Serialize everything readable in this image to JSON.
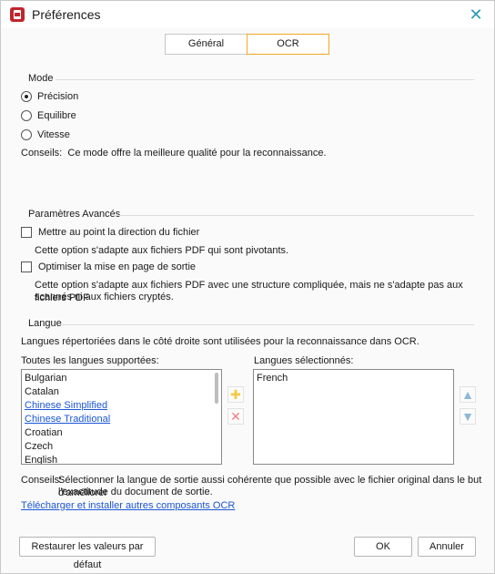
{
  "window": {
    "title": "Préférences"
  },
  "tabs": [
    {
      "label": "Général",
      "active": false
    },
    {
      "label": "OCR",
      "active": true
    }
  ],
  "mode": {
    "title": "Mode",
    "options": [
      {
        "label": "Précision",
        "checked": true
      },
      {
        "label": "Equilibre",
        "checked": false
      },
      {
        "label": "Vitesse",
        "checked": false
      }
    ],
    "tip_prefix": "Conseils:",
    "tip_text": "Ce mode offre la meilleure qualité pour la reconnaissance."
  },
  "advanced": {
    "title": "Paramètres Avancés",
    "option1_label": "Mettre au point la direction du fichier",
    "option1_checked": false,
    "option1_desc": "Cette option s'adapte aux fichiers PDF qui sont pivotants.",
    "option2_label": "Optimiser la mise en page de sortie",
    "option2_checked": false,
    "option2_desc_line1": "Cette option s'adapte aux fichiers PDF avec une structure compliquée, mais ne s'adapte pas aux fichiers PDF",
    "option2_desc_line2": "scannés ni aux fichiers cryptés."
  },
  "language": {
    "title": "Langue",
    "intro": "Langues répertoriées dans le côté droite sont utilisées pour la reconnaissance dans OCR.",
    "supported_label": "Toutes les langues supportées:",
    "selected_label": "Langues sélectionnés:",
    "supported": [
      "Bulgarian",
      "Catalan",
      "Chinese Simplified",
      "Chinese Traditional",
      "Croatian",
      "Czech",
      "English"
    ],
    "selected": [
      "French"
    ],
    "tip_prefix": "Conseils:",
    "tip_line1": "Sélectionner la langue de sortie aussi cohérente que possible avec le fichier original dans le but d'améliorer",
    "tip_line2": "l'exactitude du document de sortie.",
    "download_link": "Télécharger et installer autres composants OCR"
  },
  "icons": {
    "add": "plus-icon",
    "remove": "x-icon",
    "up": "arrow-up-icon",
    "down": "arrow-down-icon",
    "close": "close-icon",
    "accent_color": "#f5a623"
  },
  "footer": {
    "restore_label": "Restaurer les valeurs par défaut",
    "ok_label": "OK",
    "cancel_label": "Annuler"
  }
}
